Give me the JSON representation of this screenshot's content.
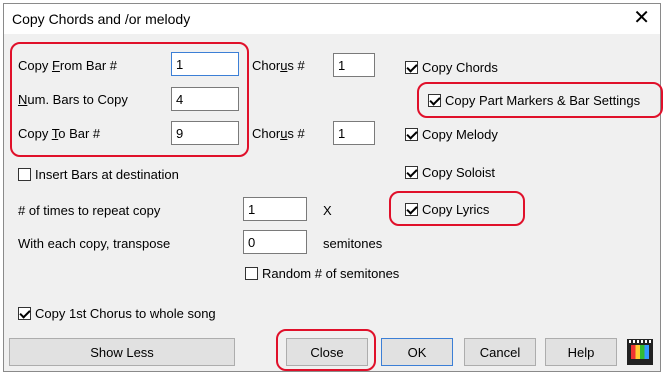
{
  "window": {
    "title": "Copy Chords and /or melody",
    "close_glyph": "✕"
  },
  "fields": {
    "copy_from_bar": {
      "label_pre": "Copy ",
      "label_u": "F",
      "label_post": "rom Bar #",
      "value": "1"
    },
    "num_bars": {
      "label_pre": "",
      "label_u": "N",
      "label_post": "um. Bars to Copy",
      "value": "4"
    },
    "copy_to_bar": {
      "label_pre": "Copy ",
      "label_u": "T",
      "label_post": "o Bar #",
      "value": "9"
    },
    "chorus1": {
      "label_pre": "Chor",
      "label_u": "u",
      "label_post": "s #",
      "value": "1"
    },
    "chorus2": {
      "label_pre": "Chor",
      "label_u": "u",
      "label_post": "s #",
      "value": "1"
    },
    "times_repeat": {
      "label": "# of times to repeat copy",
      "value": "1",
      "suffix": "X"
    },
    "transpose": {
      "label": "With each copy, transpose",
      "value": "0",
      "suffix": "semitones"
    }
  },
  "checkboxes": {
    "copy_chords": {
      "label": "Copy Chords",
      "checked": true
    },
    "copy_part_markers": {
      "label": "Copy Part Markers & Bar Settings",
      "checked": true
    },
    "copy_melody": {
      "label": "Copy Melody",
      "checked": true
    },
    "copy_soloist": {
      "label": "Copy Soloist",
      "checked": true
    },
    "copy_lyrics": {
      "label": "Copy Lyrics",
      "checked": true
    },
    "insert_bars": {
      "label": "Insert Bars at destination",
      "checked": false
    },
    "random_semitones": {
      "label": "Random # of semitones",
      "checked": false
    },
    "copy_1st_chorus": {
      "label": "Copy 1st Chorus to whole song",
      "checked": true
    }
  },
  "buttons": {
    "show_less": "Show Less",
    "close": "Close",
    "ok": "OK",
    "cancel": "Cancel",
    "help": "Help"
  },
  "icons": {
    "film": "film-icon"
  },
  "colors": {
    "highlight": "#e0102a",
    "focus": "#3c7fd6"
  }
}
